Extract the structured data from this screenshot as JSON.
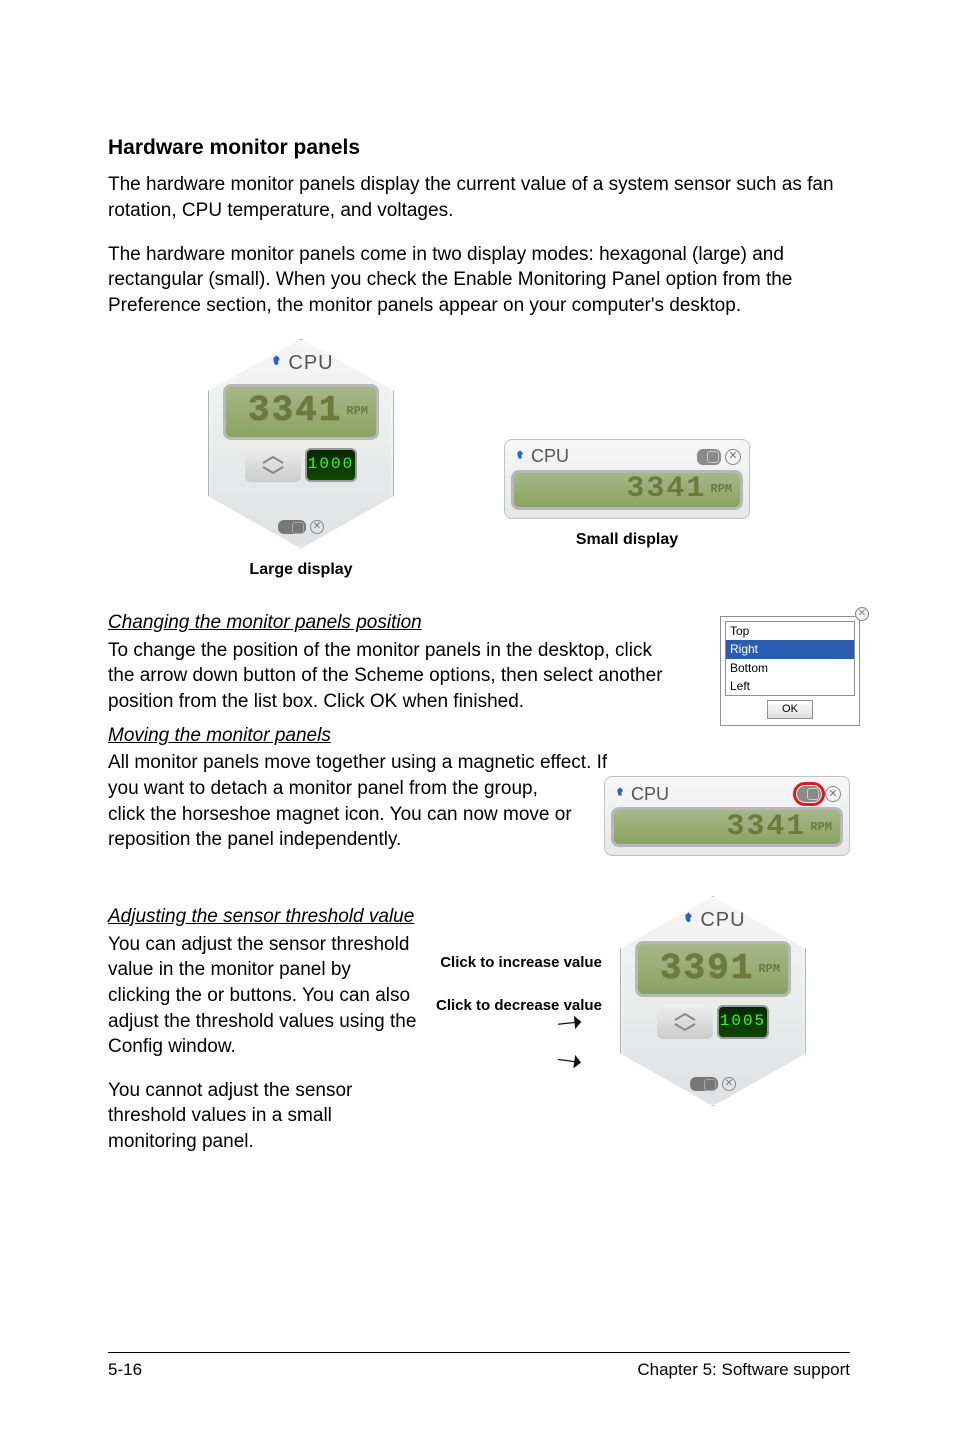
{
  "heading": "Hardware monitor panels",
  "para1": "The hardware monitor panels display the current value of a system sensor such as fan rotation, CPU temperature, and voltages.",
  "para2": "The hardware monitor panels come in two display modes: hexagonal (large) and rectangular (small). When you check the Enable Monitoring Panel option from the Preference section, the monitor panels appear on your computer's desktop.",
  "largePanel": {
    "title": "CPU",
    "value": "3341",
    "unit": "RPM",
    "threshold": "1000"
  },
  "smallPanel": {
    "title": "CPU",
    "value": "3341",
    "unit": "RPM"
  },
  "captions": {
    "large": "Large display",
    "small": "Small display"
  },
  "sec_change": {
    "title": "Changing the monitor panels position",
    "text": "To change the position of the monitor panels in the desktop, click the arrow down button of the Scheme options, then select another position from the list box. Click OK when finished."
  },
  "positionList": {
    "opts": [
      "Top",
      "Right",
      "Bottom",
      "Left"
    ],
    "selected": "Right",
    "ok": "OK"
  },
  "sec_move": {
    "title": "Moving the monitor panels",
    "text1": "All monitor panels move together using a magnetic effect. If",
    "text2": "you want to detach a monitor panel from the group, click the horseshoe magnet icon. You can now move or reposition the panel independently."
  },
  "movePanel": {
    "title": "CPU",
    "value": "3341",
    "unit": "RPM"
  },
  "sec_adjust": {
    "title": "Adjusting the sensor threshold value",
    "text1": "You can adjust the sensor threshold value in the monitor panel by clicking the  or  buttons. You can also adjust the threshold values using the Config window.",
    "text2": "You cannot adjust the sensor threshold values in a small monitoring panel."
  },
  "adjustPanel": {
    "title": "CPU",
    "value": "3391",
    "unit": "RPM",
    "threshold": "1005"
  },
  "annot": {
    "inc": "Click to increase value",
    "dec": "Click to decrease value"
  },
  "footer": {
    "left": "5-16",
    "right": "Chapter 5: Software support"
  }
}
